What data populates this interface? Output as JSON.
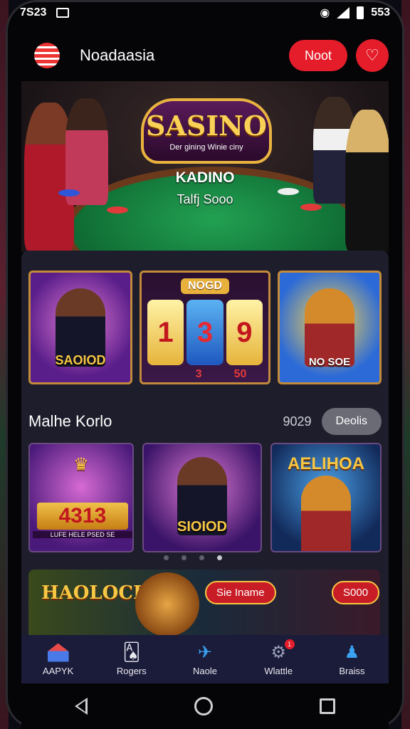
{
  "status_bar": {
    "time": "7S23",
    "battery_text": "553"
  },
  "app_bar": {
    "title": "Noadaasia",
    "action_button": "Noot"
  },
  "hero": {
    "sign_title": "SASINO",
    "sign_tagline": "Der gining Winie ciny",
    "subtitle": "KADINO",
    "subtitle2": "Talfj Sooo"
  },
  "featured_tiles": [
    {
      "label": "SAOIOD"
    },
    {
      "header": "NOGD",
      "reels": [
        "1",
        "3",
        "9"
      ],
      "footer": [
        "",
        "3",
        "50"
      ]
    },
    {
      "label": "NO SOE"
    }
  ],
  "section": {
    "title": "Malhe Korlo",
    "count": "9029",
    "details_button": "Deolis"
  },
  "game_tiles": [
    {
      "number": "4313",
      "small": "LUFE HELE PSED SE",
      "label": ""
    },
    {
      "number": "",
      "small": "",
      "label": "SIOIOD"
    },
    {
      "number": "",
      "small": "",
      "label": "AELIHOA"
    }
  ],
  "promo": {
    "title": "HAOLOCH",
    "button": "Sie Iname",
    "amount": "S000"
  },
  "bottom_nav": [
    {
      "icon": "home-icon",
      "label": "AAPYK",
      "badge": ""
    },
    {
      "icon": "cards-icon",
      "label": "Rogers",
      "badge": ""
    },
    {
      "icon": "plane-icon",
      "label": "Naole",
      "badge": ""
    },
    {
      "icon": "gear-icon",
      "label": "Wlattle",
      "badge": "1"
    },
    {
      "icon": "users-icon",
      "label": "Braiss",
      "badge": ""
    }
  ],
  "colors": {
    "accent": "#e51d2a",
    "nav_bg": "#1b1b3a",
    "card_bg": "#1d1d2b",
    "gold": "#f6c744"
  }
}
